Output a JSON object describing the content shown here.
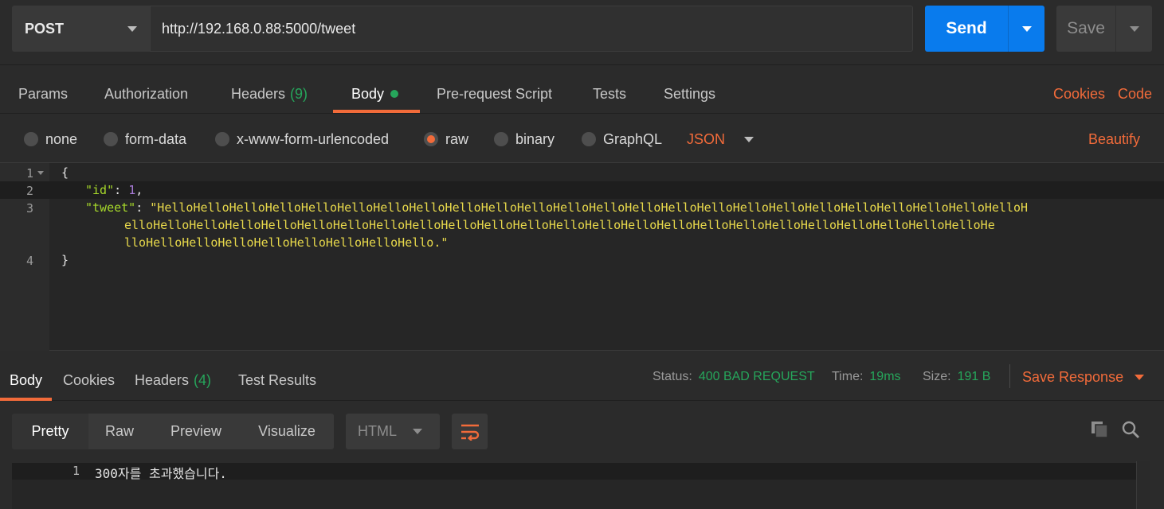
{
  "request": {
    "method": "POST",
    "url": "http://192.168.0.88:5000/tweet",
    "send_label": "Send",
    "save_label": "Save"
  },
  "request_tabs": [
    {
      "label": "Params"
    },
    {
      "label": "Authorization"
    },
    {
      "label": "Headers",
      "count": "(9)"
    },
    {
      "label": "Body",
      "active": true
    },
    {
      "label": "Pre-request Script"
    },
    {
      "label": "Tests"
    },
    {
      "label": "Settings"
    }
  ],
  "request_links": {
    "cookies": "Cookies",
    "code": "Code"
  },
  "body_modes": {
    "options": [
      "none",
      "form-data",
      "x-www-form-urlencoded",
      "raw",
      "binary",
      "GraphQL"
    ],
    "selected": "raw",
    "language": "JSON",
    "beautify": "Beautify"
  },
  "editor": {
    "line_numbers": [
      "1",
      "2",
      "3",
      "4"
    ],
    "open_brace": "{",
    "close_brace": "}",
    "id_key": "\"id\"",
    "id_value": "1",
    "tweet_key": "\"tweet\"",
    "tweet_line1": "\"HelloHelloHelloHelloHelloHelloHelloHelloHelloHelloHelloHelloHelloHelloHelloHelloHelloHelloHelloHelloHelloHelloHelloHelloH",
    "tweet_line2": "elloHelloHelloHelloHelloHelloHelloHelloHelloHelloHelloHelloHelloHelloHelloHelloHelloHelloHelloHelloHelloHelloHelloHelloHe",
    "tweet_line3": "lloHelloHelloHelloHelloHelloHelloHelloHello.\""
  },
  "response_tabs": [
    {
      "label": "Body",
      "active": true
    },
    {
      "label": "Cookies"
    },
    {
      "label": "Headers",
      "count": "(4)"
    },
    {
      "label": "Test Results"
    }
  ],
  "response_meta": {
    "status_label": "Status:",
    "status_value": "400 BAD REQUEST",
    "time_label": "Time:",
    "time_value": "19ms",
    "size_label": "Size:",
    "size_value": "191 B",
    "save_response": "Save Response"
  },
  "response_view": {
    "modes": [
      "Pretty",
      "Raw",
      "Preview",
      "Visualize"
    ],
    "selected": "Pretty",
    "format": "HTML"
  },
  "response_body": {
    "line_number": "1",
    "text": "300자를 초과했습니다."
  },
  "icons": [
    "chevron-down-icon",
    "wrap-lines-icon",
    "copy-icon",
    "search-icon"
  ],
  "colors": {
    "accent": "#f26b3a",
    "send_blue": "#097bed",
    "success_green": "#26a65b",
    "background": "#2b2b2b"
  }
}
